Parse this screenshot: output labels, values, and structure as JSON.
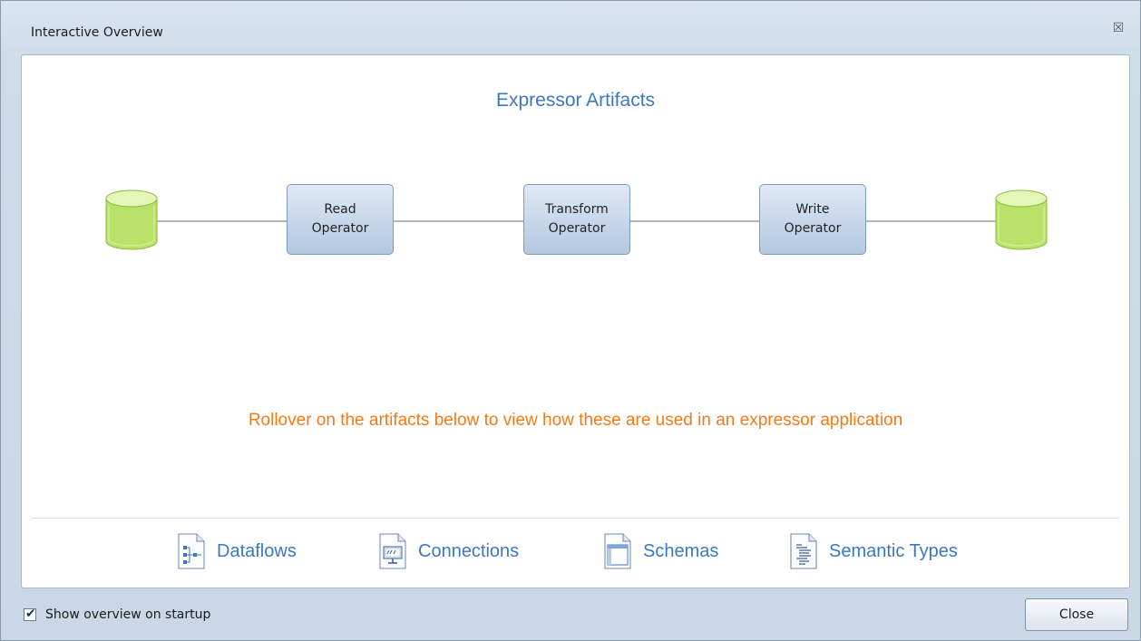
{
  "window": {
    "title": "Interactive Overview",
    "close_glyph": "☒"
  },
  "main": {
    "heading": "Expressor Artifacts",
    "diagram": {
      "operators": [
        {
          "line1": "Read",
          "line2": "Operator"
        },
        {
          "line1": "Transform",
          "line2": "Operator"
        },
        {
          "line1": "Write",
          "line2": "Operator"
        }
      ]
    },
    "hint": "Rollover on the artifacts below to view how these are used in an expressor application",
    "artifacts": [
      {
        "label": "Dataflows",
        "icon": "dataflows-icon"
      },
      {
        "label": "Connections",
        "icon": "connections-icon"
      },
      {
        "label": "Schemas",
        "icon": "schemas-icon"
      },
      {
        "label": "Semantic Types",
        "icon": "semantic-types-icon"
      }
    ]
  },
  "footer": {
    "show_on_startup_label": "Show overview on startup",
    "show_on_startup_checked": true,
    "close_label": "Close"
  },
  "colors": {
    "heading": "#3c78c2",
    "hint": "#f47a17",
    "datastore": "#c6ec7c"
  }
}
